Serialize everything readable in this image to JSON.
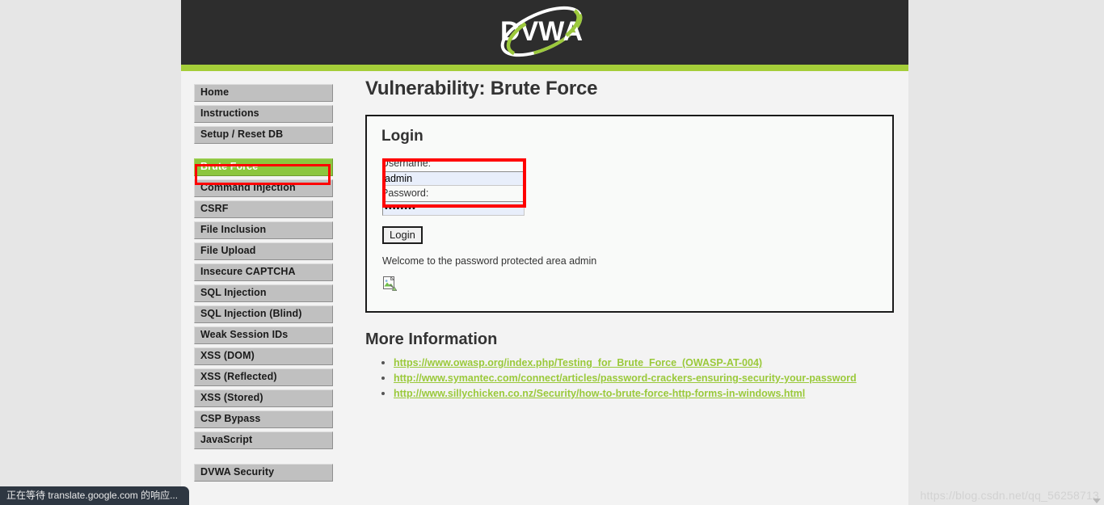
{
  "header": {
    "logo_text": "DVWA",
    "logo_alt": "dvwa-logo",
    "bar_color": "#a5ce39",
    "background_color": "#2d2d2d"
  },
  "sidebar": {
    "groups": [
      {
        "items": [
          {
            "label": "Home",
            "active": false
          },
          {
            "label": "Instructions",
            "active": false
          },
          {
            "label": "Setup / Reset DB",
            "active": false
          }
        ]
      },
      {
        "items": [
          {
            "label": "Brute Force",
            "active": true
          },
          {
            "label": "Command Injection",
            "active": false
          },
          {
            "label": "CSRF",
            "active": false
          },
          {
            "label": "File Inclusion",
            "active": false
          },
          {
            "label": "File Upload",
            "active": false
          },
          {
            "label": "Insecure CAPTCHA",
            "active": false
          },
          {
            "label": "SQL Injection",
            "active": false
          },
          {
            "label": "SQL Injection (Blind)",
            "active": false
          },
          {
            "label": "Weak Session IDs",
            "active": false
          },
          {
            "label": "XSS (DOM)",
            "active": false
          },
          {
            "label": "XSS (Reflected)",
            "active": false
          },
          {
            "label": "XSS (Stored)",
            "active": false
          },
          {
            "label": "CSP Bypass",
            "active": false
          },
          {
            "label": "JavaScript",
            "active": false
          }
        ]
      },
      {
        "items": [
          {
            "label": "DVWA Security",
            "active": false
          }
        ]
      }
    ],
    "active_label": "Brute Force",
    "active_background": "#8cc63e",
    "item_background": "#c0c0c0"
  },
  "main": {
    "page_title": "Vulnerability: Brute Force",
    "login_box": {
      "heading": "Login",
      "username_label": "Username:",
      "username_value": "admin",
      "username_placeholder": "",
      "password_label": "Password:",
      "password_value": "••••••••",
      "password_placeholder": "",
      "submit_label": "Login",
      "welcome_message": "Welcome to the password protected area admin",
      "broken_image_alt": "broken-image"
    },
    "more_information": {
      "heading": "More Information",
      "links": [
        "https://www.owasp.org/index.php/Testing_for_Brute_Force_(OWASP-AT-004)",
        "http://www.symantec.com/connect/articles/password-crackers-ensuring-security-your-password",
        "http://www.sillychicken.co.nz/Security/how-to-brute-force-http-forms-in-windows.html"
      ],
      "link_color": "#9ac93a"
    }
  },
  "annotations": {
    "color": "#ff0000",
    "nav_target": "Brute Force",
    "input_target": "credential fields"
  },
  "status_bar": {
    "text": "正在等待 translate.google.com 的响应..."
  },
  "watermark": {
    "text": "https://blog.csdn.net/qq_56258713"
  }
}
